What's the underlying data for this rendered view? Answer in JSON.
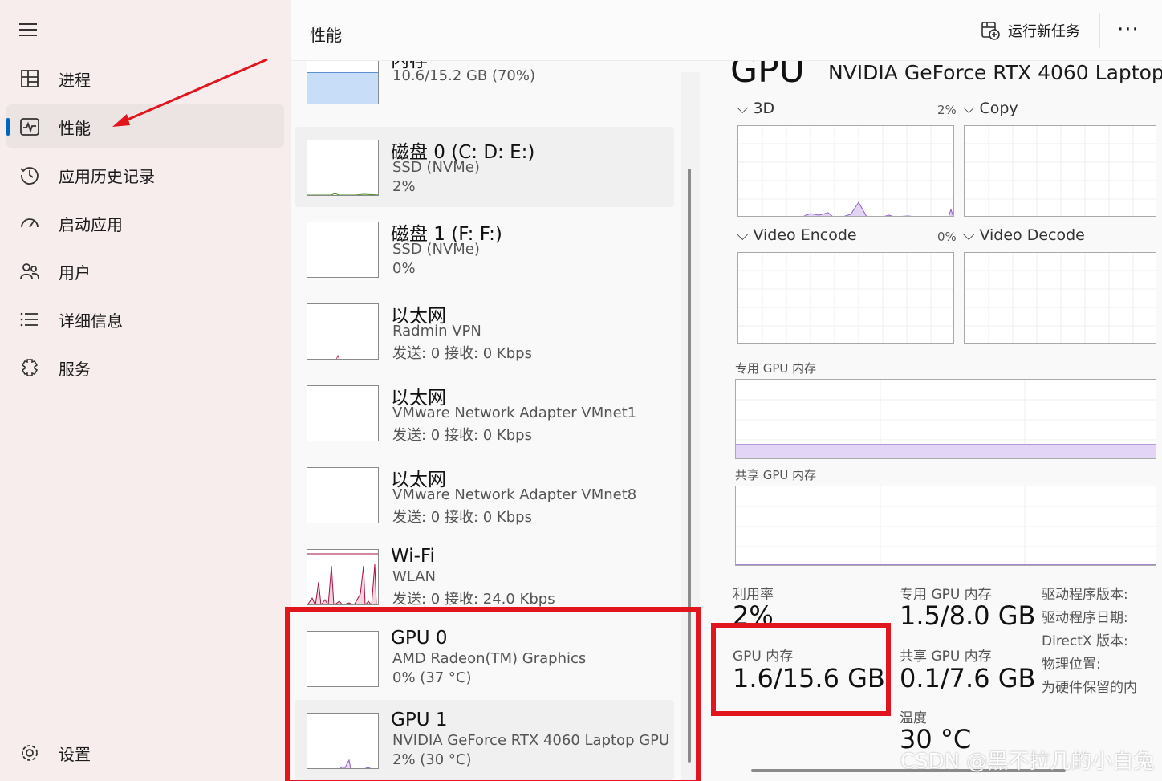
{
  "nav": {
    "items": [
      {
        "label": "进程",
        "icon": "processes-icon"
      },
      {
        "label": "性能",
        "icon": "performance-icon"
      },
      {
        "label": "应用历史记录",
        "icon": "app-history-icon"
      },
      {
        "label": "启动应用",
        "icon": "startup-apps-icon"
      },
      {
        "label": "用户",
        "icon": "users-icon"
      },
      {
        "label": "详细信息",
        "icon": "details-icon"
      },
      {
        "label": "服务",
        "icon": "services-icon"
      }
    ],
    "settings_label": "设置",
    "active_index": 1
  },
  "header": {
    "title": "性能",
    "run_task_label": "运行新任务",
    "more_label": "···"
  },
  "devices": [
    {
      "name": "内存",
      "sub1": "10.6/15.2 GB (70%)",
      "sub2": ""
    },
    {
      "name": "磁盘 0 (C: D: E:)",
      "sub1": "SSD (NVMe)",
      "sub2": "2%"
    },
    {
      "name": "磁盘 1 (F: F:)",
      "sub1": "SSD (NVMe)",
      "sub2": "0%"
    },
    {
      "name": "以太网",
      "sub1": "Radmin VPN",
      "sub2": "发送: 0 接收: 0 Kbps"
    },
    {
      "name": "以太网",
      "sub1": "VMware Network Adapter VMnet1",
      "sub2": "发送: 0 接收: 0 Kbps"
    },
    {
      "name": "以太网",
      "sub1": "VMware Network Adapter VMnet8",
      "sub2": "发送: 0 接收: 0 Kbps"
    },
    {
      "name": "Wi-Fi",
      "sub1": "WLAN",
      "sub2": "发送: 0 接收: 24.0 Kbps"
    },
    {
      "name": "GPU 0",
      "sub1": "AMD Radeon(TM) Graphics",
      "sub2": "0% (37 °C)"
    },
    {
      "name": "GPU 1",
      "sub1": "NVIDIA GeForce RTX 4060 Laptop GPU",
      "sub2": "2% (30 °C)"
    }
  ],
  "detail": {
    "title": "GPU",
    "model": "NVIDIA GeForce RTX 4060 Laptop",
    "engines": [
      {
        "label": "3D",
        "pct": "2%"
      },
      {
        "label": "Copy",
        "pct": ""
      },
      {
        "label": "Video Encode",
        "pct": "0%"
      },
      {
        "label": "Video Decode",
        "pct": ""
      }
    ],
    "dedicated_graph_label": "专用 GPU 内存",
    "shared_graph_label": "共享 GPU 内存",
    "stats": {
      "utilization_label": "利用率",
      "utilization_value": "2%",
      "dedicated_label": "专用 GPU 内存",
      "dedicated_value": "1.5/8.0 GB",
      "gpu_mem_label": "GPU 内存",
      "gpu_mem_value": "1.6/15.6 GB",
      "shared_label": "共享 GPU 内存",
      "shared_value": "0.1/7.6 GB",
      "temp_label": "温度",
      "temp_value": "30 °C"
    },
    "info_labels": [
      "驱动程序版本:",
      "驱动程序日期:",
      "DirectX 版本:",
      "物理位置:",
      "为硬件保留的内"
    ]
  },
  "watermark": "CSDN @黑不拉几的小白兔",
  "colors": {
    "accent": "#0067c0",
    "annotation_red": "#e0151e",
    "gpu_purple": "#8e5cc7",
    "wifi_red": "#a4123f",
    "memory_blue": "#c8ddf7"
  }
}
